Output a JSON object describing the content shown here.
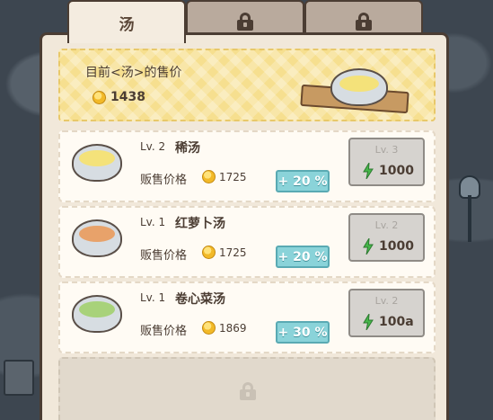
{
  "tabs": [
    {
      "label": "汤",
      "active": true
    },
    {
      "label": "",
      "icon": "lock-icon",
      "locked": true
    },
    {
      "label": "",
      "icon": "lock-icon",
      "locked": true
    }
  ],
  "header": {
    "title": "目前<汤>的售价",
    "price": "1438",
    "icon": "coin-icon"
  },
  "soups": [
    {
      "level": "Lv. 2",
      "name": "稀汤",
      "price_label": "贩售价格",
      "price": "1725",
      "bonus": "+ 20 %",
      "upgrade_level": "Lv. 3",
      "upgrade_cost": "1000",
      "soup_color": "#f4e27a",
      "bowl_icon": "thin-soup-bowl-icon"
    },
    {
      "level": "Lv. 1",
      "name": "红萝卜汤",
      "price_label": "贩售价格",
      "price": "1725",
      "bonus": "+ 20 %",
      "upgrade_level": "Lv. 2",
      "upgrade_cost": "1000",
      "soup_color": "#e8a26a",
      "bowl_icon": "carrot-soup-bowl-icon"
    },
    {
      "level": "Lv. 1",
      "name": "卷心菜汤",
      "price_label": "贩售价格",
      "price": "1869",
      "bonus": "+ 30 %",
      "upgrade_level": "Lv. 2",
      "upgrade_cost": "100a",
      "soup_color": "#a8d27a",
      "bowl_icon": "cabbage-soup-bowl-icon"
    }
  ],
  "colors": {
    "panel": "#f1e8da",
    "header": "#f6df8f",
    "bonus": "#8ad3d9",
    "upgrade_button": "#d6d3cf",
    "outline": "#4b3d33",
    "bolt": "#46b64a"
  }
}
